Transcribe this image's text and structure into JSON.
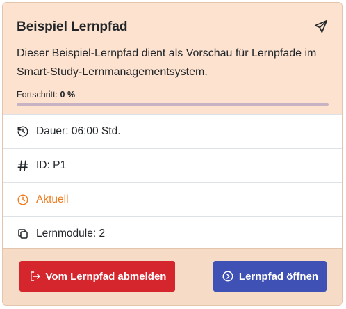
{
  "card": {
    "title": "Beispiel Lernpfad",
    "description": "Dieser Beispiel-Lernpfad dient als Vorschau für Lernpfade im Smart-Study-Lernmanagementsystem.",
    "progress_label": "Fortschritt:",
    "progress_value": "0 %",
    "progress_fraction": 0
  },
  "details": {
    "duration": "Dauer: 06:00 Std.",
    "id": "ID: P1",
    "status": "Aktuell",
    "modules": "Lernmodule: 2"
  },
  "footer": {
    "logout_label": "Vom Lernpfad abmelden",
    "open_label": "Lernpfad öffnen"
  },
  "icons": {
    "share": "send-icon",
    "duration": "history-icon",
    "id": "hash-icon",
    "status": "clock-icon",
    "modules": "copy-icon",
    "logout": "logout-icon",
    "open": "chevron-circle-right-icon"
  },
  "colors": {
    "header_bg": "#fde3cf",
    "footer_bg": "#f6dbc6",
    "status": "#f07b1d",
    "logout_button": "#d6262d",
    "open_button": "#3f51b5"
  }
}
